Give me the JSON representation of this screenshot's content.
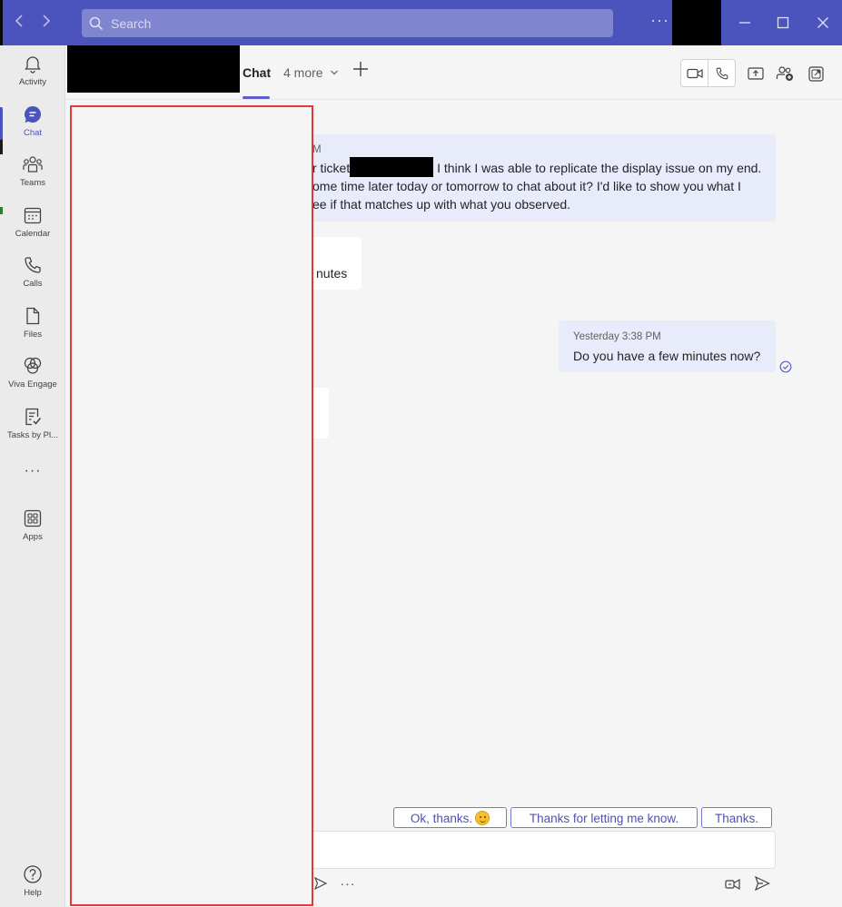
{
  "titlebar": {
    "search_placeholder": "Search",
    "more_label": "···",
    "back_label": "‹",
    "forward_label": "›",
    "minimize_label": "—",
    "maximize_label": "□",
    "close_label": "✕"
  },
  "rail": {
    "items": [
      {
        "label": "Activity",
        "icon": "bell-icon"
      },
      {
        "label": "Chat",
        "icon": "chat-icon",
        "active": true
      },
      {
        "label": "Teams",
        "icon": "teams-icon"
      },
      {
        "label": "Calendar",
        "icon": "calendar-icon"
      },
      {
        "label": "Calls",
        "icon": "phone-icon"
      },
      {
        "label": "Files",
        "icon": "file-icon"
      },
      {
        "label": "Viva Engage",
        "icon": "viva-engage-icon"
      },
      {
        "label": "Tasks by Pl...",
        "icon": "tasks-icon"
      },
      {
        "label": "···",
        "icon": "more-apps-icon"
      },
      {
        "label": "Apps",
        "icon": "apps-icon"
      }
    ],
    "help_label": "Help"
  },
  "header": {
    "tab_chat": "Chat",
    "tab_more": "4 more",
    "tab_add": "+"
  },
  "messages": {
    "m1": {
      "meta": "M",
      "line1_pre": "r ticket",
      "line1_post": "I think I was able to replicate the display issue on my end.",
      "line2": "ome time later today or tomorrow to chat about it? I'd like to show you what I",
      "line3": "ee if that matches up with what you observed."
    },
    "m2": {
      "text": "nutes"
    },
    "m3": {
      "time": "Yesterday 3:38 PM",
      "text": "Do you have a  few minutes now?"
    }
  },
  "suggested_replies": [
    "Ok, thanks.",
    "Thanks for letting me know.",
    "Thanks."
  ],
  "compose": {
    "placeholder": "",
    "more_label": "···"
  },
  "colors": {
    "brand": "#4b53bc",
    "accent": "#5b5fc7",
    "highlight": "#e03a3a",
    "bubble_self": "#e8ebfa"
  }
}
